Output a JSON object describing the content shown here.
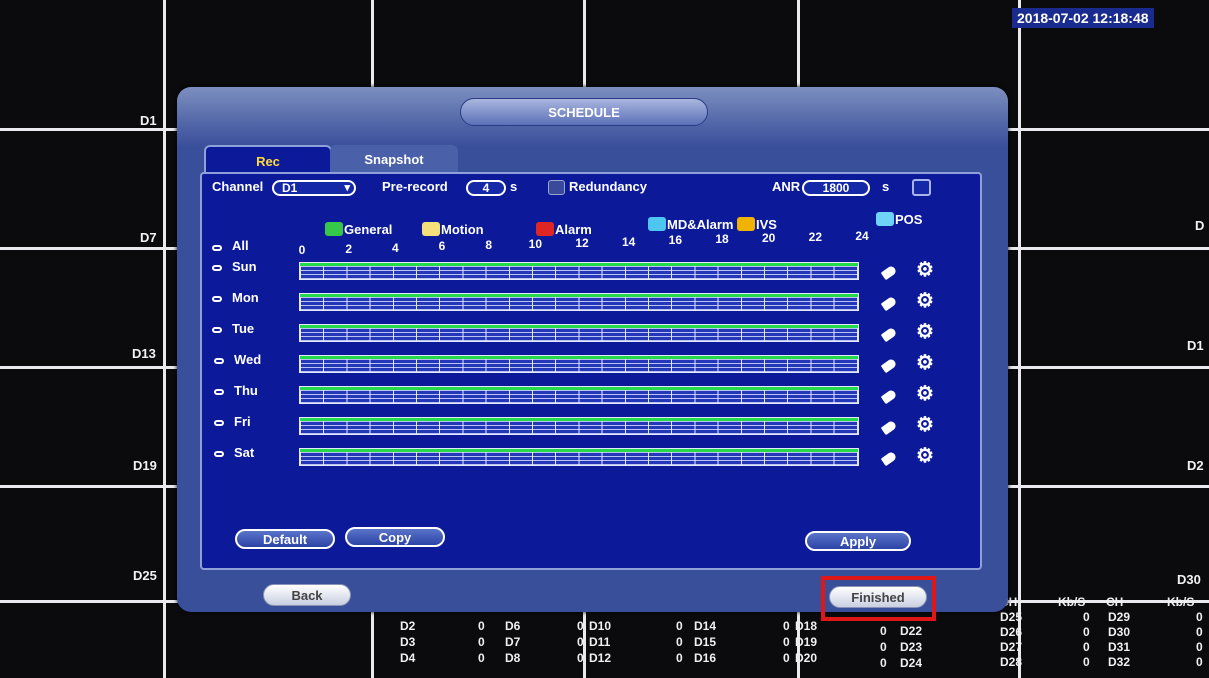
{
  "clock": "2018-07-02 12:18:48",
  "channel_labels": {
    "d1": "D1",
    "d7": "D7",
    "d13": "D13",
    "d19": "D19",
    "d25": "D25",
    "d_right_7": "D",
    "d_right_13": "D1",
    "d_right_19": "D2",
    "d30": "D30"
  },
  "dialog": {
    "title": "SCHEDULE",
    "tabs": {
      "rec": "Rec",
      "snapshot": "Snapshot"
    },
    "channel": {
      "label": "Channel",
      "value": "D1"
    },
    "prerecord": {
      "label": "Pre-record",
      "value": "4",
      "unit": "s"
    },
    "redundancy": {
      "label": "Redundancy"
    },
    "anr": {
      "label": "ANR",
      "value": "1800",
      "unit": "s"
    },
    "legend": {
      "general": "General",
      "motion": "Motion",
      "alarm": "Alarm",
      "mdalarm": "MD&Alarm",
      "ivs": "IVS",
      "pos": "POS"
    },
    "legend_colors": {
      "general": "#35c84a",
      "motion": "#f4e07a",
      "alarm": "#e02525",
      "mdalarm": "#4fc6ef",
      "ivs": "#f0b400",
      "pos": "#6fd3f7"
    },
    "all_label": "All",
    "hours": [
      "0",
      "2",
      "4",
      "6",
      "8",
      "10",
      "12",
      "14",
      "16",
      "18",
      "20",
      "22",
      "24"
    ],
    "days": [
      "Sun",
      "Mon",
      "Tue",
      "Wed",
      "Thu",
      "Fri",
      "Sat"
    ],
    "buttons": {
      "default": "Default",
      "copy": "Copy",
      "apply": "Apply",
      "back": "Back",
      "finished": "Finished"
    }
  },
  "stats": {
    "col1": [
      "D2",
      "D3",
      "D4"
    ],
    "col1v": [
      "0",
      "0",
      "0"
    ],
    "col2": [
      "D6",
      "D7",
      "D8"
    ],
    "col2v": [
      "0",
      "0",
      "0"
    ],
    "col3": [
      "D10",
      "D11",
      "D12"
    ],
    "col3v": [
      "0",
      "0",
      "0"
    ],
    "col4": [
      "D14",
      "D15",
      "D16"
    ],
    "col4v": [
      "0",
      "0",
      "0"
    ],
    "col5": [
      "D18",
      "D19",
      "D20"
    ],
    "col5v": [
      "0",
      "0",
      "0"
    ],
    "col6": [
      "D22",
      "D23",
      "D24"
    ],
    "header": {
      "ch": "CH",
      "kbs": "Kb/S",
      "ch2": "CH",
      "kbs2": "Kb/S"
    },
    "col7": [
      "D25",
      "D26",
      "D27",
      "D28"
    ],
    "col7v": [
      "0",
      "0",
      "0",
      "0"
    ],
    "col8": [
      "D29",
      "D30",
      "D31",
      "D32"
    ],
    "col8v": [
      "0",
      "0",
      "0",
      "0"
    ]
  }
}
